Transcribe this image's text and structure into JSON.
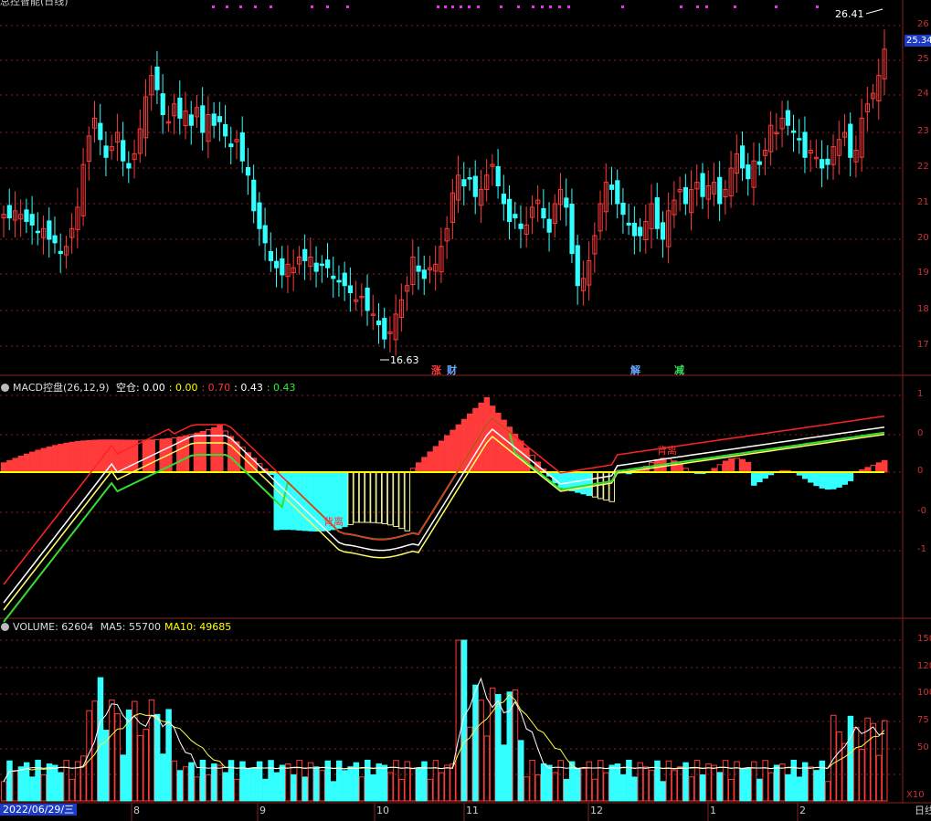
{
  "title_partial": "总控智能(日线)",
  "price_axis": {
    "ticks": [
      "26",
      "25",
      "24",
      "23",
      "22",
      "21",
      "20",
      "19",
      "18",
      "17"
    ],
    "current": "25.34"
  },
  "annotations": {
    "high": "26.41",
    "low": "16.63"
  },
  "events": [
    {
      "text": "涨",
      "color": "#ff3b3b"
    },
    {
      "text": "财",
      "color": "#6aa8ff"
    },
    {
      "text": "解",
      "color": "#6aa8ff"
    },
    {
      "text": "减",
      "color": "#33dd55"
    }
  ],
  "macd": {
    "label": "MACD控盘(26,12,9)",
    "items": [
      {
        "text": "空仓: 0.00",
        "color": "#ffffff"
      },
      {
        "text": ": 0.00",
        "color": "#ffff00"
      },
      {
        "text": ": 0.70",
        "color": "#ff3333"
      },
      {
        "text": ": 0.43",
        "color": "#ffffff"
      },
      {
        "text": ": 0.43",
        "color": "#33ee33"
      }
    ],
    "ticks": [
      "1",
      "0",
      "0",
      "-0",
      "-1"
    ],
    "divergence": "背离"
  },
  "volume": {
    "label": "VOLUME: 62604",
    "ma5": "MA5: 55700",
    "ma10": "MA10: 49685",
    "ticks": [
      "150",
      "120",
      "100",
      "75",
      "50"
    ],
    "unit": "X10"
  },
  "dates": {
    "current": "2022/06/29/三",
    "months": [
      "8",
      "9",
      "10",
      "11",
      "12",
      "1",
      "2"
    ],
    "period": "日线"
  },
  "colors": {
    "up": "#ff3b3b",
    "down": "#33ffff",
    "grid": "#8a1f1f"
  }
}
